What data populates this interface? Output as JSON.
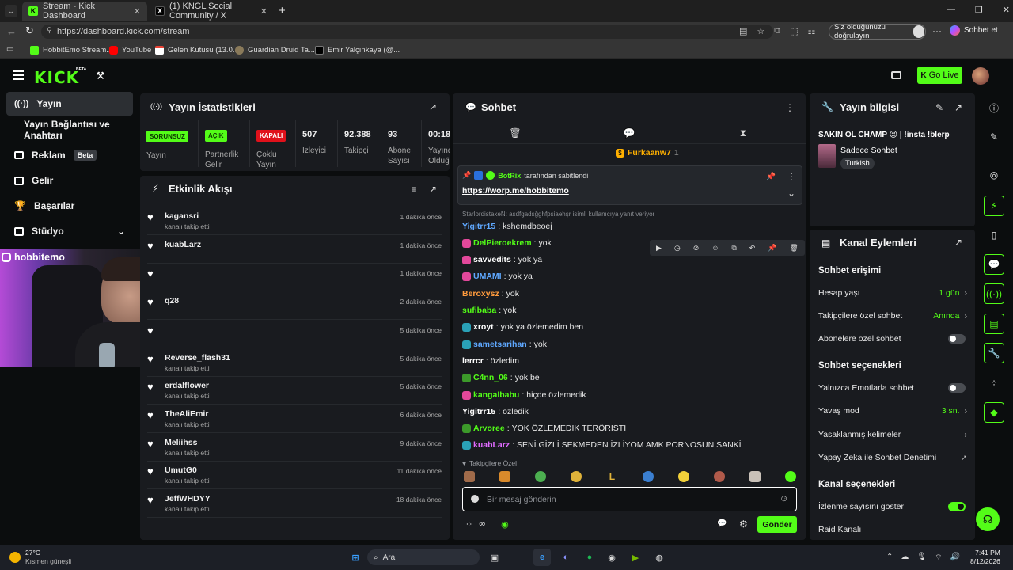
{
  "browser": {
    "tabs": [
      {
        "title": "Stream - Kick Dashboard",
        "active": true
      },
      {
        "title": "(1) KNGL Social Community / X",
        "active": false
      }
    ],
    "url": "https://dashboard.kick.com/stream",
    "verify_label": "Siz olduğunuzu doğrulayın",
    "chat_label": "Sohbet et",
    "bookmarks": [
      "HobbitEmo Stream...",
      "YouTube",
      "Gelen Kutusu (13.0...",
      "Guardian Druid Ta...",
      "Emir Yalçınkaya (@..."
    ]
  },
  "header": {
    "logo": "KICK",
    "logo_badge": "BETA",
    "go_live": "Go Live"
  },
  "sidebar": {
    "items": [
      {
        "label": "Yayın",
        "active": true
      },
      {
        "label": "Yayın Bağlantısı ve Anahtarı"
      },
      {
        "label": "Reklam",
        "badge": "Beta"
      },
      {
        "label": "Gelir"
      },
      {
        "label": "Başarılar"
      },
      {
        "label": "Stüdyo"
      }
    ]
  },
  "webcam": {
    "username": "hobbitemo"
  },
  "stats": {
    "title": "Yayın İstatistikleri",
    "status": [
      {
        "badge": "SORUNSUZ",
        "label": "Yayın",
        "color": "#53fc18"
      },
      {
        "badge": "AÇIK",
        "label": "Partnerlik Gelir",
        "color": "#53fc18"
      },
      {
        "badge": "KAPALI",
        "label": "Çoklu Yayın",
        "color": "#e0111b"
      }
    ],
    "numbers": [
      {
        "value": "507",
        "label": "İzleyici"
      },
      {
        "value": "92.388",
        "label": "Takipçi"
      },
      {
        "value": "93",
        "label": "Abone Sayısı"
      },
      {
        "value": "00:18:",
        "label": "Yayında Olduğu Süre"
      }
    ]
  },
  "events": {
    "title": "Etkinlik Akışı",
    "items": [
      {
        "name": "kagansri",
        "action": "kanalı takip etti",
        "time": "1 dakika önce"
      },
      {
        "name": "kuabLarz",
        "action": "",
        "time": "1 dakika önce"
      },
      {
        "name": "",
        "action": "",
        "time": "1 dakika önce"
      },
      {
        "name": "q28",
        "action": "",
        "time": "2 dakika önce"
      },
      {
        "name": "",
        "action": "",
        "time": "5 dakika önce"
      },
      {
        "name": "Reverse_flash31",
        "action": "kanalı takip etti",
        "time": "5 dakika önce"
      },
      {
        "name": "erdalflower",
        "action": "kanalı takip etti",
        "time": "5 dakika önce"
      },
      {
        "name": "TheAliEmir",
        "action": "kanalı takip etti",
        "time": "6 dakika önce"
      },
      {
        "name": "Meliihss",
        "action": "kanalı takip etti",
        "time": "9 dakika önce"
      },
      {
        "name": "UmutG0",
        "action": "kanalı takip etti",
        "time": "11 dakika önce"
      },
      {
        "name": "JeffWHDYY",
        "action": "kanalı takip etti",
        "time": "18 dakika önce"
      }
    ]
  },
  "chat": {
    "title": "Sohbet",
    "top_gifter": "Furkaanw7",
    "top_gifter_count": "1",
    "pinned_by": "BotRix",
    "pinned_suffix": "tarafından sabitlendi",
    "pinned_link": "https://worp.me/hobbitemo",
    "reply_note": "StarlordistakeN: asdfgadsğghfpsiaehşr isimli kullanıcıya yanıt veriyor",
    "messages": [
      {
        "user": "Yigitrr15",
        "text": "kshemdbeoej",
        "color": "#5fa8ff",
        "badge": ""
      },
      {
        "user": "DelPieroekrem",
        "text": "yok",
        "color": "#53fc18",
        "badge": "pink"
      },
      {
        "user": "savvedits",
        "text": "yok ya",
        "color": "#ffffff",
        "badge": "pink"
      },
      {
        "user": "UMAMI",
        "text": "yok ya",
        "color": "#5fa8ff",
        "badge": "pink"
      },
      {
        "user": "Beroxysz",
        "text": "yok",
        "color": "#ff9b3d",
        "badge": ""
      },
      {
        "user": "sufibaba",
        "text": "yok",
        "color": "#53fc18",
        "badge": ""
      },
      {
        "user": "xroyt",
        "text": "yok ya özlemedim ben",
        "color": "#ffffff",
        "badge": "teal"
      },
      {
        "user": "sametsarihan",
        "text": "yok",
        "color": "#5fa8ff",
        "badge": "teal"
      },
      {
        "user": "lerrcr",
        "text": "özledim",
        "color": "#ffffff",
        "badge": ""
      },
      {
        "user": "C4nn_06",
        "text": "yok be",
        "color": "#53fc18",
        "badge": "green"
      },
      {
        "user": "kangalbabu",
        "text": "hiçde özlemedik",
        "color": "#53fc18",
        "badge": "pink"
      },
      {
        "user": "Yigitrr15",
        "text": "özledik",
        "color": "#ffffff",
        "badge": ""
      },
      {
        "user": "Arvoree",
        "text": "YOK ÖZLEMEDİK TERÖRİSTİ",
        "color": "#53fc18",
        "badge": "green"
      },
      {
        "user": "kuabLarz",
        "text": "SENİ GİZLİ SEKMEDEN İZLİYOM AMK PORNOSUN SANKİ",
        "color": "#e06bff",
        "badge": "teal"
      }
    ],
    "followers_only": "Takipçilere Özel",
    "input_placeholder": "Bir mesaj gönderin",
    "send_label": "Gönder"
  },
  "stream_info": {
    "title": "Yayın bilgisi",
    "stream_title": "SAKİN OL CHAMP 😉 | !insta !blerp",
    "category": "Sadece Sohbet",
    "language": "Turkish"
  },
  "channel_actions": {
    "title": "Kanal Eylemleri",
    "chat_access": "Sohbet erişimi",
    "account_age": {
      "label": "Hesap yaşı",
      "value": "1 gün"
    },
    "followers_chat": {
      "label": "Takipçilere özel sohbet",
      "value": "Anında"
    },
    "subs_chat": {
      "label": "Abonelere özel sohbet",
      "on": false
    },
    "chat_options": "Sohbet seçenekleri",
    "emote_only": {
      "label": "Yalnızca Emotlarla sohbet",
      "on": false
    },
    "slow_mode": {
      "label": "Yavaş mod",
      "value": "3 sn."
    },
    "banned_words": "Yasaklanmış kelimeler",
    "ai_moderation": "Yapay Zeka ile Sohbet Denetimi",
    "channel_options": "Kanal seçenekleri",
    "show_viewers": {
      "label": "İzlenme sayısını göster",
      "on": true
    },
    "raid": "Raid Kanalı"
  },
  "taskbar": {
    "temperature": "27°C",
    "weather": "Kısmen güneşli",
    "search": "Ara",
    "time": "7:41 PM",
    "date": "8/12/2026"
  },
  "colors": {
    "brand": "#53fc18",
    "panel": "#191b1f",
    "bg": "#0b0d0e"
  }
}
